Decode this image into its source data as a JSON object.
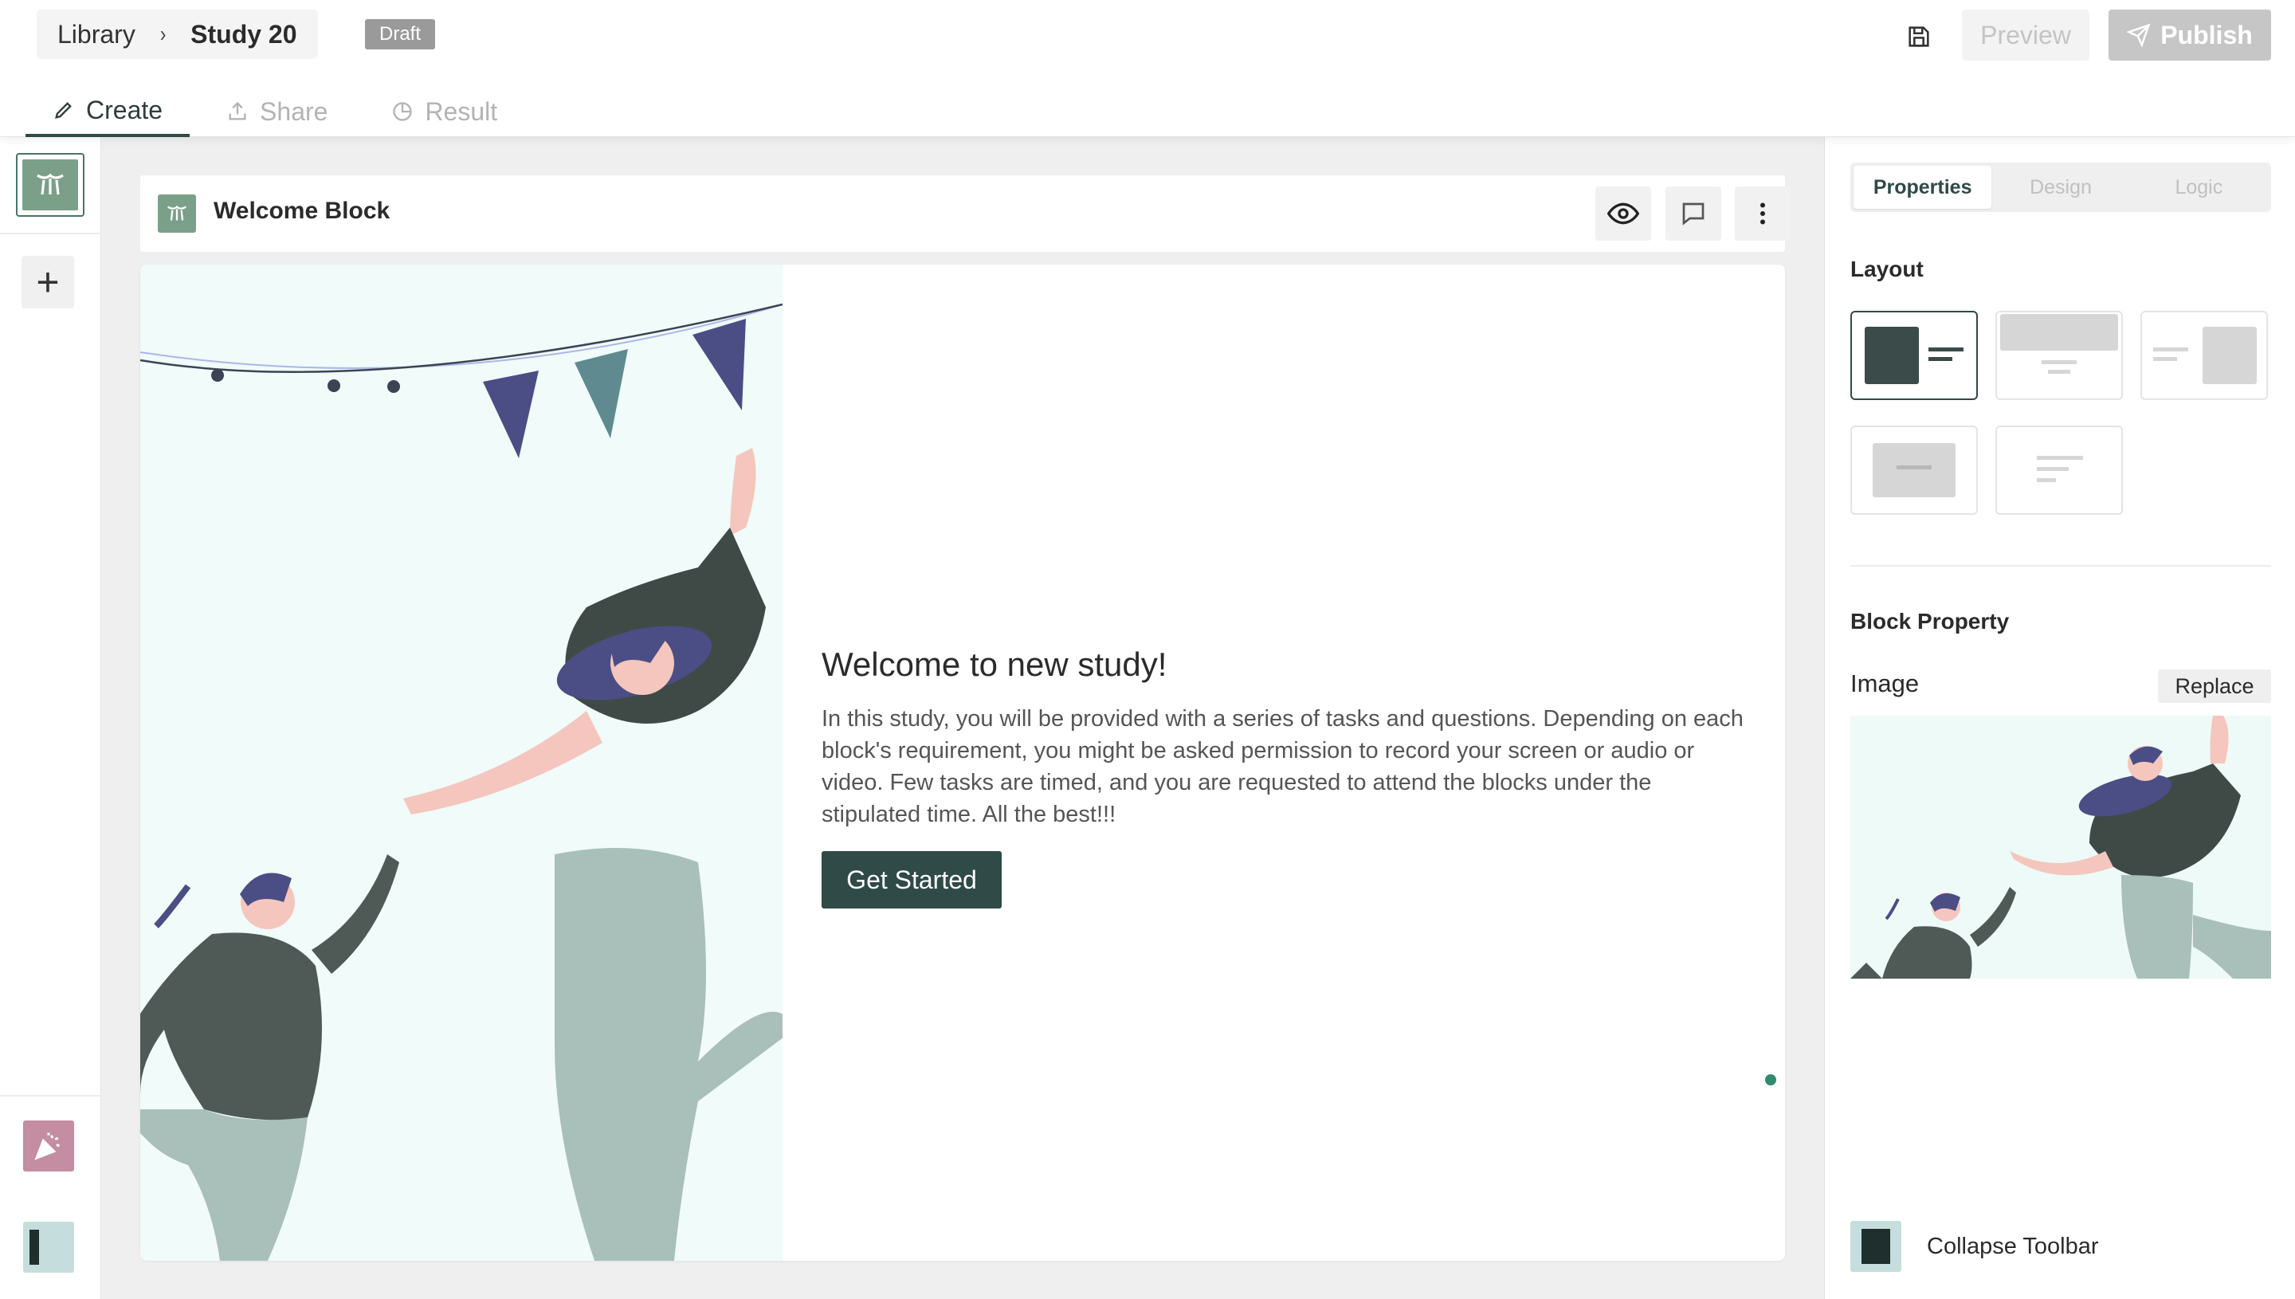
{
  "breadcrumb": {
    "library": "Library",
    "chevron": "›",
    "study": "Study 20",
    "status_badge": "Draft"
  },
  "toolbar": {
    "preview_label": "Preview",
    "publish_label": "Publish"
  },
  "tabs": [
    {
      "label": "Create",
      "icon": "pencil-icon",
      "active": true
    },
    {
      "label": "Share",
      "icon": "share-icon",
      "active": false
    },
    {
      "label": "Result",
      "icon": "pie-chart-icon",
      "active": false
    }
  ],
  "left_rail": {
    "add_symbol": "+"
  },
  "block": {
    "title": "Welcome Block",
    "heading": "Welcome to new study!",
    "body": "In this study, you will be provided with a series of tasks and questions. Depending on each block's requirement, you might be asked permission to record your screen or audio or video. Few tasks are timed, and you are requested to attend the blocks under the stipulated time. All the best!!!",
    "cta_label": "Get Started"
  },
  "panel": {
    "tabs": [
      {
        "label": "Properties",
        "active": true
      },
      {
        "label": "Design",
        "active": false
      },
      {
        "label": "Logic",
        "active": false
      }
    ],
    "layout_heading": "Layout",
    "block_property_heading": "Block Property",
    "image_label": "Image",
    "replace_label": "Replace",
    "collapse_label": "Collapse Toolbar"
  },
  "colors": {
    "accent": "#2f4a47",
    "illustration_bg": "#f0fbfa",
    "publish_disabled": "#c6c6c6",
    "status_dot": "#2e8b6f"
  }
}
